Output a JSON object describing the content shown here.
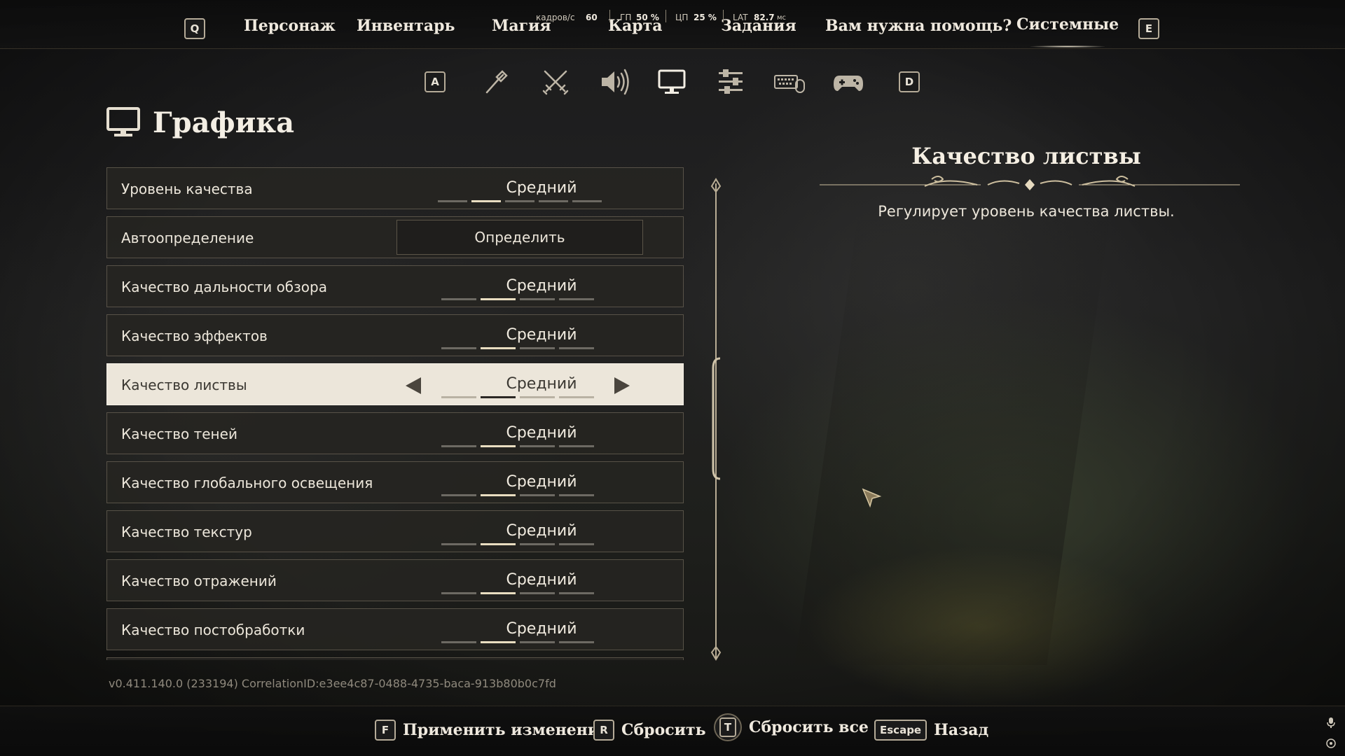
{
  "nav": {
    "left_key": "Q",
    "right_key": "E",
    "tabs": [
      {
        "label": "Персонаж"
      },
      {
        "label": "Инвентарь"
      },
      {
        "label": "Магия"
      },
      {
        "label": "Карта"
      },
      {
        "label": "Задания"
      },
      {
        "label": "Вам нужна помощь?"
      },
      {
        "label": "Системные"
      }
    ],
    "active_tab": "Системные"
  },
  "perf": {
    "fps_label": "кадров/с",
    "fps_value": "60",
    "gpu_label": "ГП",
    "gpu_value": "50 %",
    "cpu_label": "ЦП",
    "cpu_value": "25 %",
    "lat_label": "LAT",
    "lat_value": "82.7",
    "lat_unit": "мс"
  },
  "categories": {
    "left_key": "A",
    "right_key": "D",
    "icons": [
      "torch-icon",
      "crossed-swords-icon",
      "speaker-icon",
      "monitor-icon",
      "sliders-icon",
      "keyboard-mouse-icon",
      "gamepad-icon"
    ],
    "active": "monitor-icon"
  },
  "page": {
    "title": "Графика"
  },
  "settings": [
    {
      "label": "Уровень качества",
      "value": "Средний",
      "segments": 5,
      "level": 1
    },
    {
      "label": "Автоопределение",
      "button": "Определить"
    },
    {
      "label": "Качество дальности обзора",
      "value": "Средний",
      "segments": 4,
      "level": 1
    },
    {
      "label": "Качество эффектов",
      "value": "Средний",
      "segments": 4,
      "level": 1
    },
    {
      "label": "Качество листвы",
      "value": "Средний",
      "segments": 4,
      "level": 1,
      "selected": true
    },
    {
      "label": "Качество теней",
      "value": "Средний",
      "segments": 4,
      "level": 1
    },
    {
      "label": "Качество глобального освещения",
      "value": "Средний",
      "segments": 4,
      "level": 1
    },
    {
      "label": "Качество текстур",
      "value": "Средний",
      "segments": 4,
      "level": 1
    },
    {
      "label": "Качество отражений",
      "value": "Средний",
      "segments": 4,
      "level": 1
    },
    {
      "label": "Качество постобработки",
      "value": "Средний",
      "segments": 4,
      "level": 1
    }
  ],
  "description": {
    "title": "Качество листвы",
    "text": "Регулирует уровень качества листвы."
  },
  "version": "v0.411.140.0 (233194) CorrelationID:e3ee4c87-0488-4735-baca-913b80b0c7fd",
  "actions": [
    {
      "key": "F",
      "label": "Применить изменения"
    },
    {
      "key": "R",
      "label": "Сбросить"
    },
    {
      "key": "T",
      "label": "Сбросить все"
    },
    {
      "key": "Escape",
      "label": "Назад"
    }
  ],
  "colors": {
    "accent": "#e9ddc0",
    "selected_row": "#ece6da",
    "row_bg": "#262421"
  }
}
